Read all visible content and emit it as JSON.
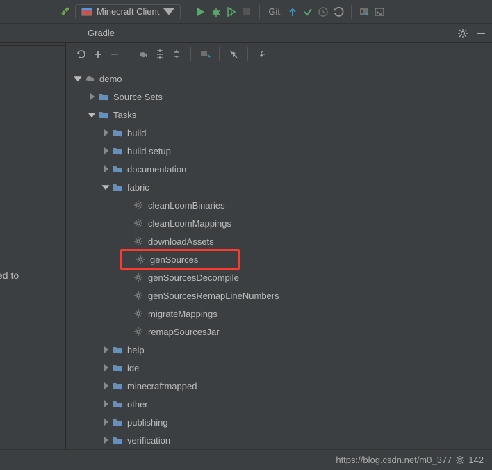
{
  "toolbar": {
    "run_config": "Minecraft Client",
    "git_label": "Git:"
  },
  "panel": {
    "title": "Gradle"
  },
  "left_panel": {
    "clipped_text": "ed to"
  },
  "tree": {
    "root": "demo",
    "source_sets": "Source Sets",
    "tasks": "Tasks",
    "folders": {
      "build": "build",
      "build_setup": "build setup",
      "documentation": "documentation",
      "fabric": "fabric",
      "help": "help",
      "ide": "ide",
      "minecraftmapped": "minecraftmapped",
      "other": "other",
      "publishing": "publishing",
      "verification": "verification"
    },
    "fabric_tasks": {
      "cleanLoomBinaries": "cleanLoomBinaries",
      "cleanLoomMappings": "cleanLoomMappings",
      "downloadAssets": "downloadAssets",
      "genSources": "genSources",
      "genSourcesDecompile": "genSourcesDecompile",
      "genSourcesRemapLineNumbers": "genSourcesRemapLineNumbers",
      "migrateMappings": "migrateMappings",
      "remapSourcesJar": "remapSourcesJar"
    }
  },
  "footer": {
    "url_left": "https://blog.csdn.net/m0_377",
    "url_right": "142"
  }
}
